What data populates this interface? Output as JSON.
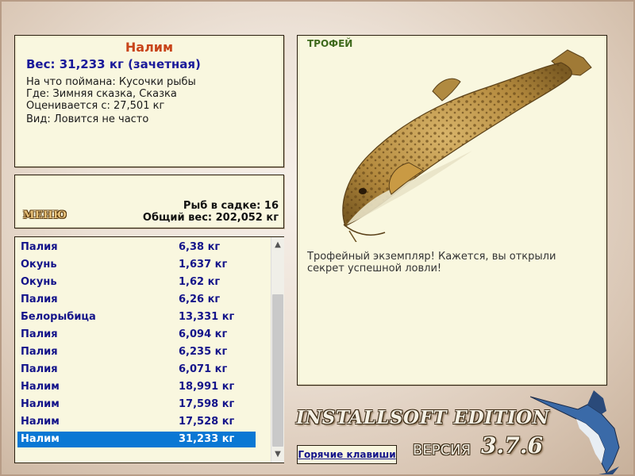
{
  "info": {
    "title": "Налим",
    "weight": "Вес: 31,233 кг (зачетная)",
    "bait": "На что поймана: Кусочки рыбы",
    "place": "Где: Зимняя сказка, Сказка",
    "rated": "Оценивается с: 27,501 кг",
    "kind": "Вид: Ловится не часто"
  },
  "summary": {
    "menu_label": "МЕНЮ",
    "fish_count": "Рыб в садке: 16",
    "total_weight": "Общий вес: 202,052 кг"
  },
  "catch_list": [
    {
      "name": "Палия",
      "weight": "6,38 кг"
    },
    {
      "name": "Окунь",
      "weight": "1,637 кг"
    },
    {
      "name": "Окунь",
      "weight": "1,62 кг"
    },
    {
      "name": "Палия",
      "weight": "6,26 кг"
    },
    {
      "name": "Белорыбица",
      "weight": "13,331 кг"
    },
    {
      "name": "Палия",
      "weight": "6,094 кг"
    },
    {
      "name": "Палия",
      "weight": "6,235 кг"
    },
    {
      "name": "Палия",
      "weight": "6,071 кг"
    },
    {
      "name": "Налим",
      "weight": "18,991 кг"
    },
    {
      "name": "Налим",
      "weight": "17,598 кг"
    },
    {
      "name": "Налим",
      "weight": "17,528 кг"
    },
    {
      "name": "Налим",
      "weight": "31,233 кг"
    }
  ],
  "selected_index": 11,
  "trophy": {
    "label": "ТРОФЕЙ",
    "description": "Трофейный экземпляр! Кажется, вы открыли секрет успешной ловли!"
  },
  "footer": {
    "brand": "INSTALLSOFT EDITION",
    "version_label": "ВЕРСИЯ",
    "version": "3.7.6",
    "hotkeys": "Горячие клавиши"
  },
  "colors": {
    "selection": "#0a78d4",
    "list_text": "#14148a",
    "title": "#c8441a"
  }
}
